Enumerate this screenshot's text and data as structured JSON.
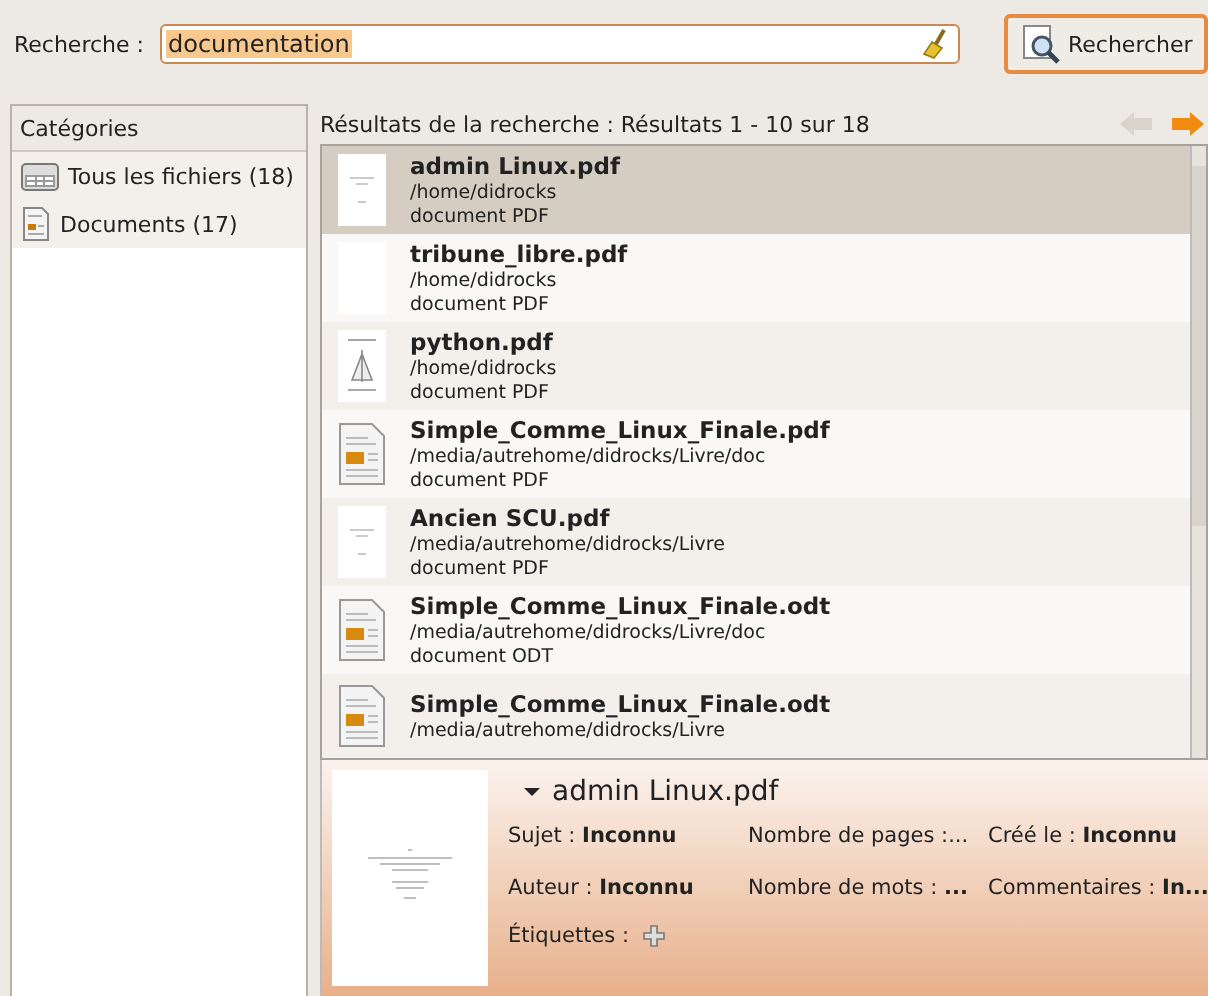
{
  "search": {
    "label": "Recherche :",
    "value": "documentation",
    "button": "Rechercher"
  },
  "categories": {
    "header": "Catégories",
    "items": [
      {
        "label": "Tous les fichiers (18)",
        "kind": "all"
      },
      {
        "label": "Documents (17)",
        "kind": "documents"
      }
    ]
  },
  "results": {
    "header": "Résultats de la recherche : Résultats 1 - 10 sur 18",
    "back_disabled": true,
    "forward_disabled": false,
    "rows": [
      {
        "name": "admin Linux.pdf",
        "path": "/home/didrocks",
        "type": "document PDF",
        "kind": "page",
        "selected": true
      },
      {
        "name": "tribune_libre.pdf",
        "path": "/home/didrocks",
        "type": "document PDF",
        "kind": "blank",
        "selected": false
      },
      {
        "name": "python.pdf",
        "path": "/home/didrocks",
        "type": "document PDF",
        "kind": "cover",
        "selected": false
      },
      {
        "name": "Simple_Comme_Linux_Finale.pdf",
        "path": "/media/autrehome/didrocks/Livre/doc",
        "type": "document PDF",
        "kind": "doc",
        "selected": false
      },
      {
        "name": "Ancien SCU.pdf",
        "path": "/media/autrehome/didrocks/Livre",
        "type": "document PDF",
        "kind": "page",
        "selected": false
      },
      {
        "name": "Simple_Comme_Linux_Finale.odt",
        "path": "/media/autrehome/didrocks/Livre/doc",
        "type": "document ODT",
        "kind": "doc",
        "selected": false
      },
      {
        "name": "Simple_Comme_Linux_Finale.odt",
        "path": "/media/autrehome/didrocks/Livre",
        "kind": "doc",
        "selected": false
      }
    ]
  },
  "details": {
    "title": "admin Linux.pdf",
    "expanded": true,
    "fields": [
      "Sujet : **Inconnu**",
      "Nombre de pages :...",
      "Créé le : **Inconnu**",
      "Auteur : **Inconnu**",
      "Nombre de mots : **...**",
      "Commentaires : **In...**"
    ],
    "tags_label": "Étiquettes :"
  }
}
